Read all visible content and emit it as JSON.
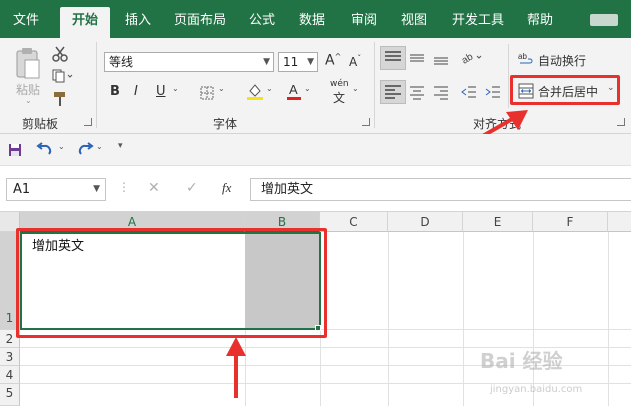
{
  "menubar": {
    "tabs": [
      "文件",
      "开始",
      "插入",
      "页面布局",
      "公式",
      "数据",
      "审阅",
      "视图",
      "开发工具",
      "帮助"
    ],
    "active_tab": "开始"
  },
  "ribbon": {
    "clipboard": {
      "label": "剪贴板",
      "paste_label": "粘贴"
    },
    "font": {
      "label": "字体",
      "font_name": "等线",
      "font_size": "11",
      "pinyin_glyph": "wén",
      "pinyin_char": "文"
    },
    "alignment": {
      "label": "对齐方式",
      "wrap_text": "自动换行",
      "merge_center": "合并后居中"
    }
  },
  "formula_bar": {
    "name_box": "A1",
    "fx": "fx",
    "value": "增加英文"
  },
  "grid": {
    "columns": [
      "A",
      "B",
      "C",
      "D",
      "E",
      "F"
    ],
    "selected_columns": [
      "A",
      "B"
    ],
    "rows": [
      "1",
      "2",
      "3",
      "4",
      "5"
    ],
    "cell_a1": "增加英文"
  },
  "watermark": {
    "logo_text": "Bai 经验",
    "url": "jingyan.baidu.com"
  },
  "colors": {
    "brand": "#217346",
    "highlight": "#e8302d",
    "merged_shade": "#c8c8c8"
  }
}
